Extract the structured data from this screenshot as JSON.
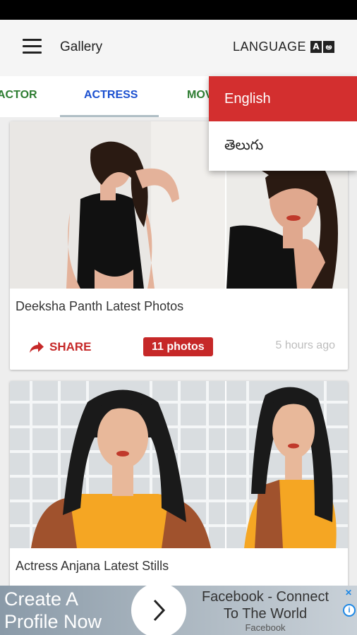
{
  "app_bar": {
    "title": "Gallery",
    "language_label": "LANGUAGE",
    "language_icon_glyphs": [
      "A",
      "అ"
    ]
  },
  "tabs": [
    {
      "label": "ACTOR"
    },
    {
      "label": "ACTRESS"
    },
    {
      "label": "MOVIES"
    }
  ],
  "language_menu": {
    "items": [
      {
        "label": "English",
        "selected": true
      },
      {
        "label": "తెలుగు",
        "selected": false
      }
    ]
  },
  "cards": [
    {
      "title": "Deeksha Panth Latest Photos",
      "share_label": "SHARE",
      "photo_count": "11 photos",
      "time_ago": "5 hours ago"
    },
    {
      "title": "Actress Anjana Latest Stills"
    }
  ],
  "ad": {
    "left_line1": "Create A",
    "left_line2": "Profile Now",
    "right_line1": "Facebook - Connect",
    "right_line2": "To The World",
    "brand": "Facebook",
    "close": "✕",
    "info": "i"
  },
  "colors": {
    "accent_red": "#c62828",
    "tab_active": "#1a4fd0",
    "tab_inactive": "#2e7d32"
  }
}
